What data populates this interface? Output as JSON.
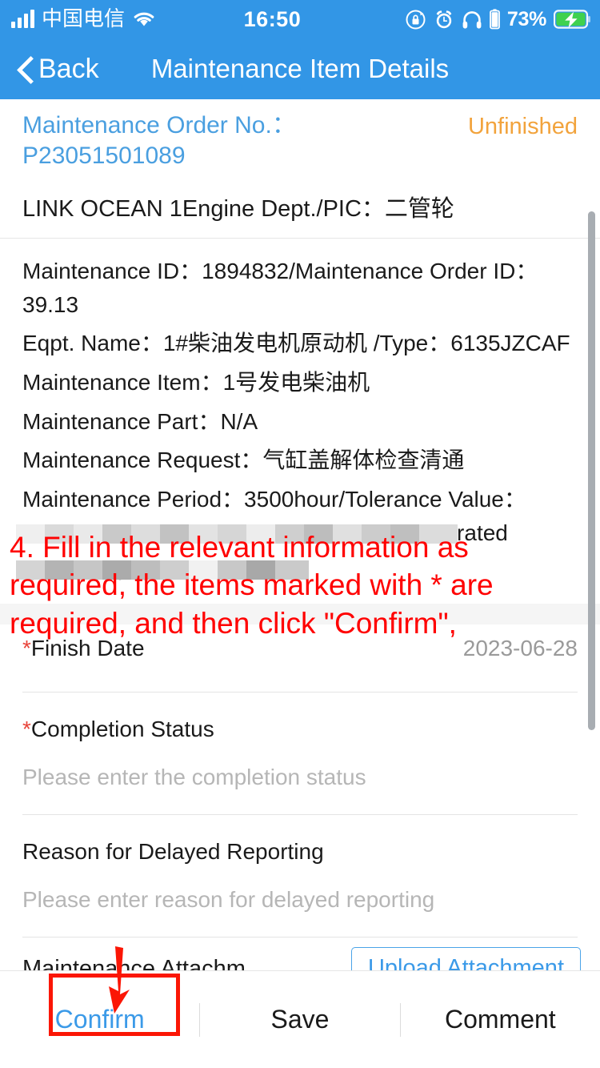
{
  "status_bar": {
    "carrier": "中国电信",
    "time": "16:50",
    "battery_percent": "73%",
    "icons": [
      "signal-bars-icon",
      "wifi-icon",
      "rotation-lock-icon",
      "alarm-clock-icon",
      "headphones-icon",
      "headphone-battery-icon",
      "battery-charging-icon"
    ]
  },
  "nav": {
    "back_label": "Back",
    "title": "Maintenance Item Details"
  },
  "order_header": {
    "order_no_label": "Maintenance Order No.：P23051501089",
    "status": "Unfinished",
    "vessel_line": "LINK OCEAN 1Engine Dept./PIC：二管轮"
  },
  "details": [
    "Maintenance ID：1894832/Maintenance Order ID：39.13",
    "Eqpt. Name：1#柴油发电机原动机 /Type：6135JZCAF",
    "Maintenance Item：1号发电柴油机",
    "Maintenance Part：N/A",
    "Maintenance Request：气缸盖解体检查清通",
    "Maintenance Period：3500hour/Tolerance Value：±150hour/Maintenance Source：Plan Generated",
    "Item Identifier：N/A"
  ],
  "form": {
    "finish_date": {
      "star": "*",
      "label": "Finish Date",
      "value": "2023-06-28"
    },
    "completion_status": {
      "star": "*",
      "label": "Completion Status",
      "placeholder": "Please enter the completion status",
      "value": ""
    },
    "delayed_reason": {
      "label": "Reason for Delayed Reporting",
      "placeholder": "Please enter reason for delayed reporting",
      "value": ""
    },
    "attachment": {
      "label": "Maintenance Attachm...",
      "button": "Upload Attachment"
    }
  },
  "bottom_bar": {
    "confirm": "Confirm",
    "save": "Save",
    "comment": "Comment"
  },
  "annotation": {
    "text": "4. Fill in the relevant information as required, the items marked with * are required, and then click \"Confirm\",",
    "color": "#ff0000",
    "highlight_target": "Confirm"
  },
  "colors": {
    "brand_blue": "#3296e6",
    "link_blue": "#3b9ae8",
    "status_orange": "#f2a33c",
    "required_red": "#e8443a",
    "annotation_red": "#ff0000"
  }
}
